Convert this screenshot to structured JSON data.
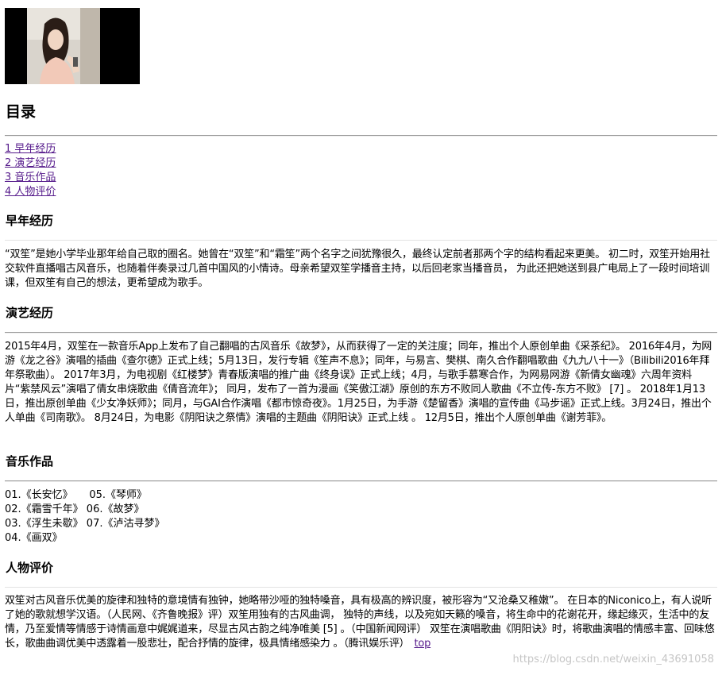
{
  "toc": {
    "title": "目录",
    "items": [
      {
        "label": "1 早年经历 "
      },
      {
        "label": "2 演艺经历"
      },
      {
        "label": "3 音乐作品"
      },
      {
        "label": "4 人物评价"
      }
    ]
  },
  "sections": {
    "early": {
      "title": "早年经历",
      "text": "“双笙”是她小学毕业那年给自己取的圈名。她曾在“双笙”和“霜笙”两个名字之间犹豫很久，最终认定前者那两个字的结构看起来更美。 初二时，双笙开始用社交软件直播唱古风音乐，也随着伴奏录过几首中国风的小情诗。母亲希望双笙学播音主持，以后回老家当播音员， 为此还把她送到县广电局上了一段时间培训课，但双笙有自己的想法，更希望成为歌手。"
    },
    "career": {
      "title": "演艺经历",
      "text": "2015年4月，双笙在一款音乐App上发布了自己翻唱的古风音乐《故梦》，从而获得了一定的关注度；同年，推出个人原创单曲《采茶纪》。 2016年4月，为网游《龙之谷》演唱的插曲《查尔德》正式上线；5月13日，发行专辑《笙声不息》；同年，与易言、樊棋、南久合作翻唱歌曲《九九八十一》（Bilibili2016年拜年祭歌曲）。 2017年3月，为电视剧《红楼梦》青春版演唱的推广曲《终身误》正式上线；4月，与歌手慕寒合作，为网易网游《新倩女幽魂》六周年资料片“紫禁风云”演唱了倩女串烧歌曲《倩音流年》； 同月，发布了一首为漫画《笑傲江湖》原创的东方不败同人歌曲《不立传-东方不败》 [7] 。 2018年1月13日，推出原创单曲《少女净妖师》；同月，与GAI合作演唱《都市惊奇夜》。1月25日，为手游《楚留香》演唱的宣传曲《马步谣》正式上线。3月24日，推出个人单曲《司南歌》。 8月24日，为电影《阴阳诀之祭情》演唱的主题曲《阴阳诀》正式上线 。 12月5日，推出个人原创单曲《谢芳菲》。"
    },
    "works": {
      "title": "音乐作品",
      "rows": [
        "01.《长安忆》     05.《琴师》",
        "02.《霜雪千年》 06.《故梦》",
        "03.《浮生未歇》 07.《泸沽寻梦》",
        "04.《画双》"
      ]
    },
    "reviews": {
      "title": "人物评价",
      "text": "双笙对古风音乐优美的旋律和独特的意境情有独钟，她略带沙哑的独特嗓音，具有极高的辨识度，被形容为“又沧桑又稚嫩”。 在日本的Niconico上，有人说听了她的歌就想学汉语。（人民网、《齐鲁晚报》评）双笙用独有的古风曲调， 独特的声线，以及宛如天籁的嗓音，将生命中的花谢花开，缘起缘灭，生活中的友情，乃至爱情等情感于诗情画意中娓娓道来，尽显古风古韵之纯净唯美 [5] 。（中国新闻网评） 双笙在演唱歌曲《阴阳诀》时，将歌曲演唱的情感丰富、回味悠长，歌曲曲调优美中透露着一股悲壮，配合抒情的旋律，极具情绪感染力 。（腾讯娱乐评）",
      "top_link": "top"
    }
  },
  "watermark": "https://blog.csdn.net/weixin_43691058",
  "colors": {
    "link": "#551a8b",
    "rule": "#9a9a9a"
  }
}
